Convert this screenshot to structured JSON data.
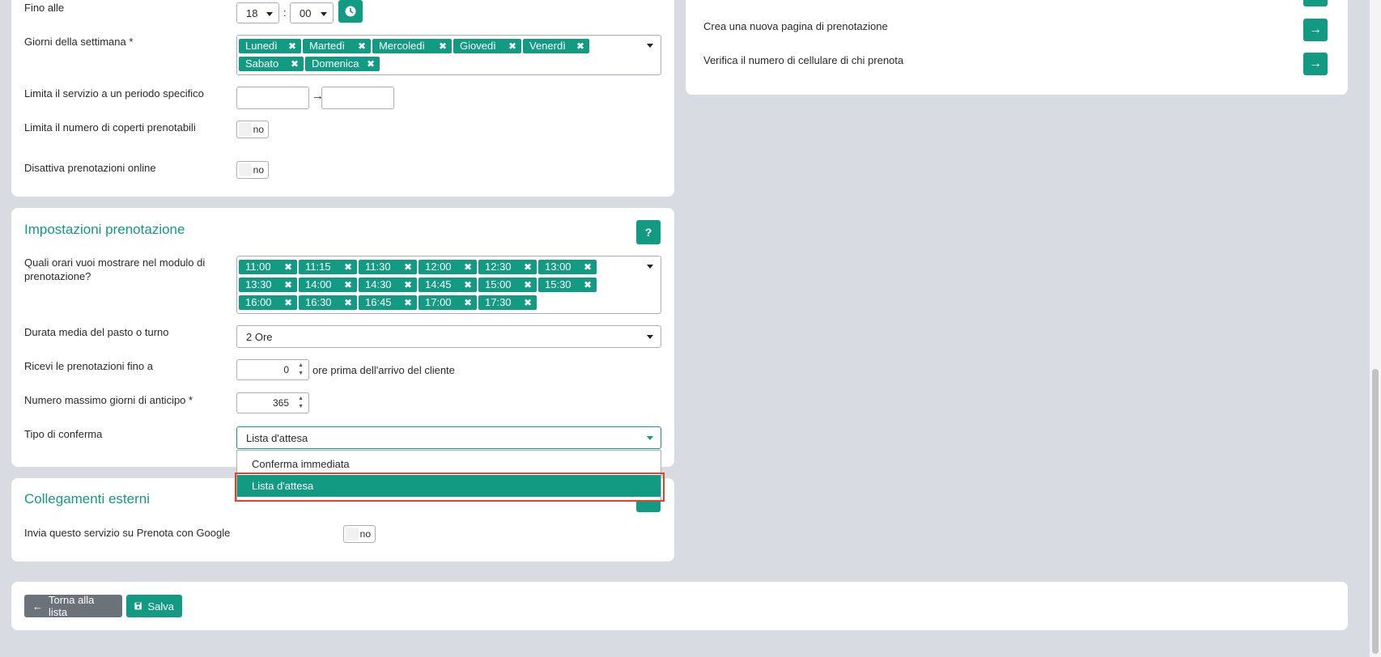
{
  "schedule": {
    "until_label": "Fino alle",
    "hour": "18",
    "minute": "00",
    "time_sep": ":",
    "weekdays_label": "Giorni della settimana *",
    "weekdays": [
      "Lunedì",
      "Martedì",
      "Mercoledì",
      "Giovedì",
      "Venerdì",
      "Sabato",
      "Domenica"
    ],
    "period_label": "Limita il servizio a un periodo specifico",
    "period_arrow": "→",
    "covers_label": "Limita il numero di coperti prenotabili",
    "covers_toggle": "no",
    "disable_online_label": "Disattiva prenotazioni online",
    "disable_online_toggle": "no"
  },
  "booking": {
    "title": "Impostazioni prenotazione",
    "help": "?",
    "times_label": "Quali orari vuoi mostrare nel modulo di prenotazione?",
    "times": [
      "11:00",
      "11:15",
      "11:30",
      "12:00",
      "12:30",
      "13:00",
      "13:30",
      "14:00",
      "14:30",
      "14:45",
      "15:00",
      "15:30",
      "16:00",
      "16:30",
      "16:45",
      "17:00",
      "17:30"
    ],
    "duration_label": "Durata media del pasto o turno",
    "duration_value": "2 Ore",
    "until_label": "Ricevi le prenotazioni fino a",
    "until_value": "0",
    "until_suffix": "ore prima dell'arrivo del cliente",
    "max_days_label": "Numero massimo giorni di anticipo *",
    "max_days_value": "365",
    "confirm_label": "Tipo di conferma",
    "confirm_value": "Lista d'attesa",
    "confirm_options": [
      "Conferma immediata",
      "Lista d'attesa"
    ]
  },
  "external": {
    "title": "Collegamenti esterni",
    "google_label": "Invia questo servizio su Prenota con Google",
    "google_toggle": "no"
  },
  "side_links": [
    "Crea una nuova pagina di prenotazione",
    "Verifica il numero di cellulare di chi prenota"
  ],
  "footer": {
    "back_label": "Torna alla lista",
    "save_label": "Salva"
  },
  "colors": {
    "accent": "#129b82",
    "highlight_border": "#e2412c",
    "back_btn": "#6c727a"
  }
}
